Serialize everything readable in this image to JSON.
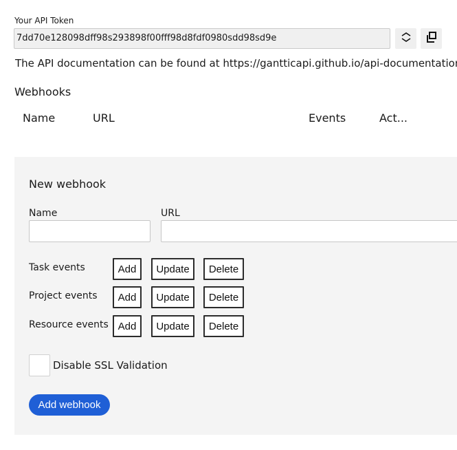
{
  "api_token": {
    "label": "Your API Token",
    "value": "7dd70e128098dff98s293898f00fff98d8fdf0980sdd98sd9e",
    "refresh_icon": "refresh-icon",
    "copy_icon": "copy-icon"
  },
  "documentation_text": "The API documentation can be found at https://gantticapi.github.io/api-documentation",
  "webhooks": {
    "title": "Webhooks",
    "columns": [
      "Name",
      "URL",
      "Events",
      "Act..."
    ]
  },
  "new_webhook": {
    "title": "New webhook",
    "name_label": "Name",
    "url_label": "URL",
    "name_value": "",
    "url_value": "",
    "event_rows": [
      {
        "label": "Task events",
        "buttons": [
          "Add",
          "Update",
          "Delete"
        ]
      },
      {
        "label": "Project events",
        "buttons": [
          "Add",
          "Update",
          "Delete"
        ]
      },
      {
        "label": "Resource events",
        "buttons": [
          "Add",
          "Update",
          "Delete"
        ]
      }
    ],
    "ssl_label": "Disable SSL Validation",
    "ssl_checked": false,
    "submit_label": "Add webhook"
  },
  "colors": {
    "primary_button": "#1f5fd6",
    "panel_background": "#f4f4f4",
    "token_field_background": "#f0f0f0"
  }
}
